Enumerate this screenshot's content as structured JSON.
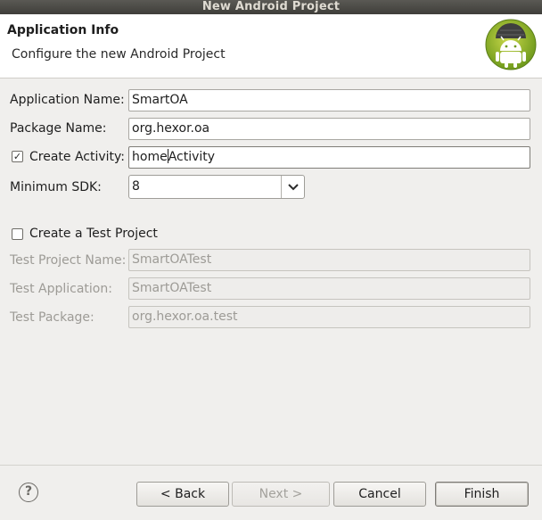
{
  "window": {
    "title": "New Android Project"
  },
  "header": {
    "title": "Application Info",
    "subtitle": "Configure the new Android Project",
    "logo_icon": "android-robot-icon"
  },
  "form": {
    "application_name": {
      "label": "Application Name:",
      "value": "SmartOA"
    },
    "package_name": {
      "label": "Package Name:",
      "value": "org.hexor.oa"
    },
    "create_activity": {
      "label": "Create Activity:",
      "checked": true,
      "value_before_caret": "home",
      "value_after_caret": "Activity"
    },
    "minimum_sdk": {
      "label": "Minimum SDK:",
      "value": "8"
    }
  },
  "test_project": {
    "checkbox_label": "Create a Test Project",
    "checked": false,
    "test_project_name": {
      "label": "Test Project Name:",
      "value": "SmartOATest"
    },
    "test_application": {
      "label": "Test Application:",
      "value": "SmartOATest"
    },
    "test_package": {
      "label": "Test Package:",
      "value": "org.hexor.oa.test"
    }
  },
  "buttons": {
    "help_icon": "?",
    "back": "< Back",
    "next": "Next >",
    "cancel": "Cancel",
    "finish": "Finish"
  },
  "colors": {
    "title_bar": "#4b4a46",
    "android_green": "#a4c639"
  }
}
